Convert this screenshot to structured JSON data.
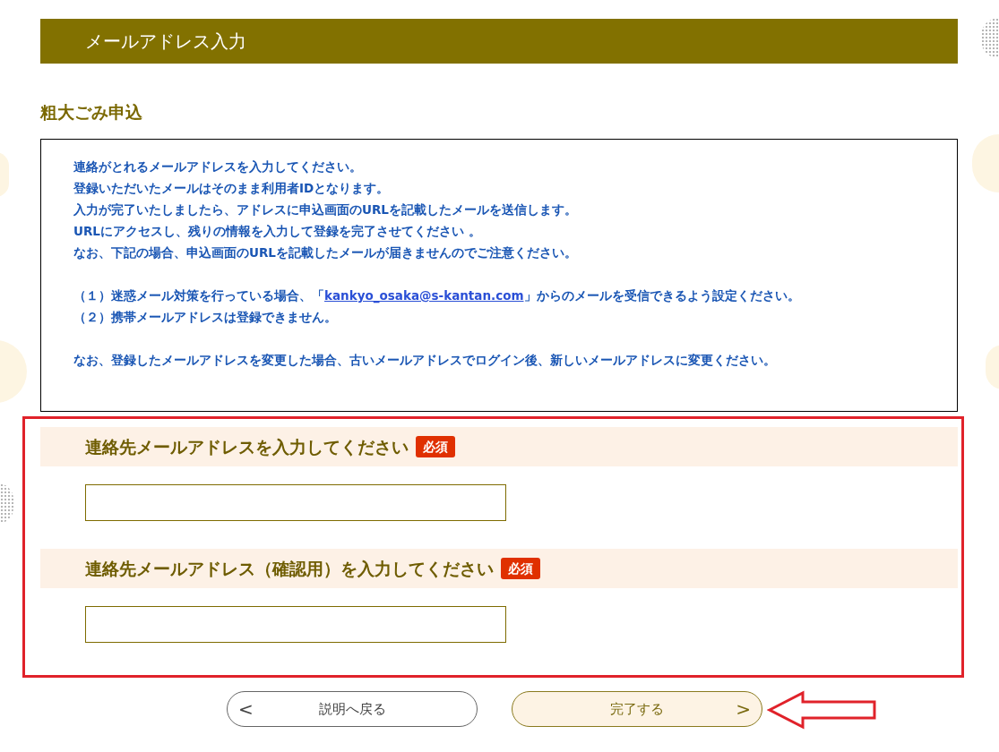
{
  "header": {
    "title": "メールアドレス入力"
  },
  "page_title": "粗大ごみ申込",
  "notice": {
    "blocks": [
      {
        "lines": [
          {
            "kind": "text",
            "text": "連絡がとれるメールアドレスを入力してください。"
          },
          {
            "kind": "text",
            "text": "登録いただいたメールはそのまま利用者IDとなります。"
          },
          {
            "kind": "text",
            "text": "入力が完了いたしましたら、アドレスに申込画面のURLを記載したメールを送信します。"
          },
          {
            "kind": "text",
            "text": "URLにアクセスし、残りの情報を入力して登録を完了させてください 。"
          },
          {
            "kind": "text",
            "text": "なお、下記の場合、申込画面のURLを記載したメールが届きませんのでご注意ください。"
          }
        ]
      },
      {
        "lines": [
          {
            "kind": "link",
            "before": "（１）迷惑メール対策を行っている場合、「",
            "link": "kankyo_osaka@s-kantan.com",
            "after": "」からのメールを受信できるよう設定ください。"
          },
          {
            "kind": "text",
            "text": "（２）携帯メールアドレスは登録できません。"
          }
        ]
      },
      {
        "lines": [
          {
            "kind": "text",
            "text": "なお、登録したメールアドレスを変更した場合、古いメールアドレスでログイン後、新しいメールアドレスに変更ください。"
          }
        ]
      }
    ]
  },
  "fields": [
    {
      "label": "連絡先メールアドレスを入力してください",
      "badge": "必須"
    },
    {
      "label": "連絡先メールアドレス（確認用）を入力してください",
      "badge": "必須"
    }
  ],
  "buttons": [
    {
      "kind": "back",
      "label": "説明へ戻る",
      "arrow": "<"
    },
    {
      "kind": "next",
      "label": "完了する",
      "arrow": ">"
    }
  ]
}
